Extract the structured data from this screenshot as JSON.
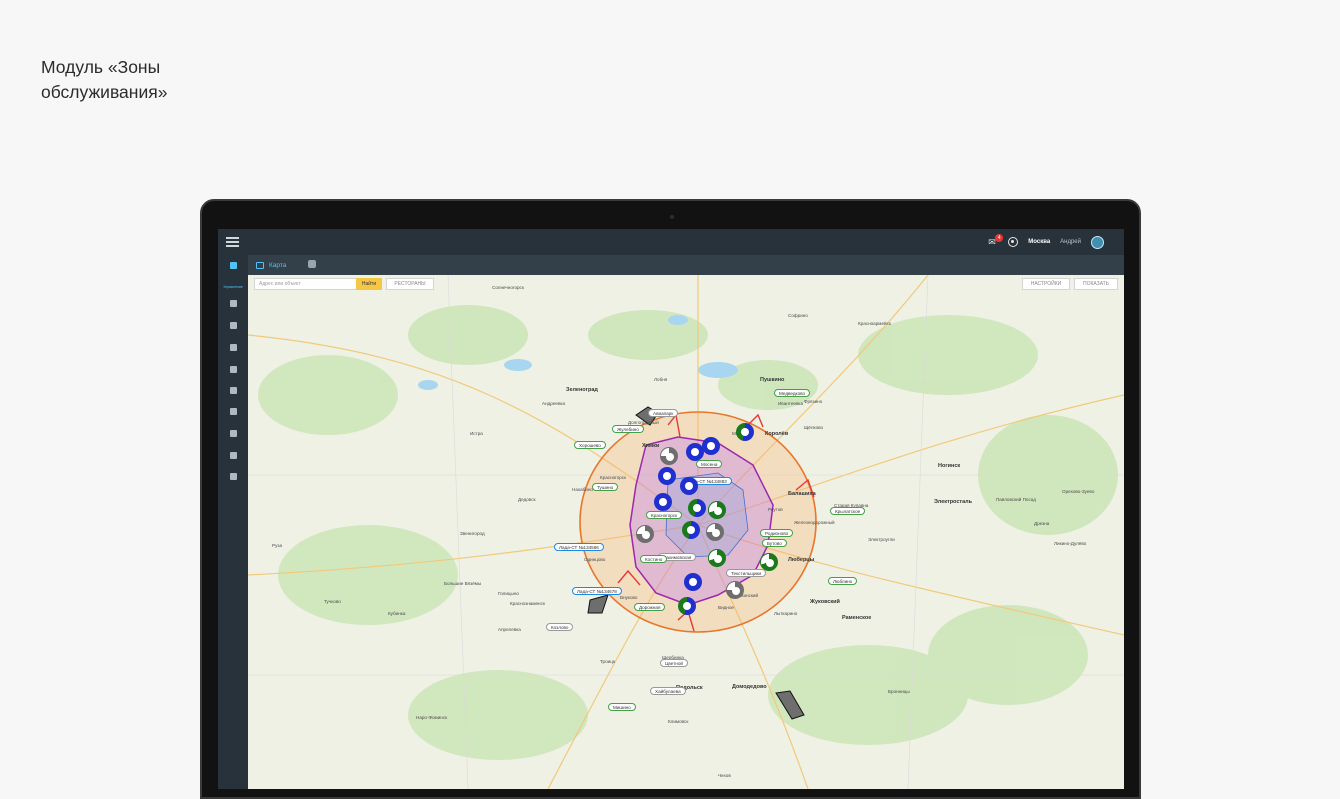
{
  "caption": "Модуль «Зоны обслуживания»",
  "topbar": {
    "notifications_count": "4",
    "city": "Москва",
    "user": "Андрей"
  },
  "tabs": {
    "map_label": "Карта"
  },
  "sidebar": {
    "active_label": "Управление"
  },
  "toolbar": {
    "search_placeholder": "Адрес или объект",
    "search_button": "Найти",
    "restaurants_button": "РЕСТОРАНЫ",
    "settings_button": "НАСТРОЙКИ",
    "show_button": "ПОКАЗАТЬ"
  },
  "map": {
    "places": [
      "Солнечногорск",
      "Зеленоград",
      "Андреевка",
      "Лобня",
      "Пушкино",
      "Долгопрудный",
      "Королёв",
      "Щёлково",
      "Мытищи",
      "Химки",
      "Красногорск",
      "Балашиха",
      "Железнодорожный",
      "Реутов",
      "Люберцы",
      "Жуковский",
      "Раменское",
      "Видное",
      "Домодедово",
      "Подольск",
      "Троицк",
      "Одинцово",
      "Внуково",
      "Истра",
      "Ногинск",
      "Электросталь",
      "Звенигород",
      "Кубинка",
      "Апрелевка",
      "Климовск",
      "Наро-Фоминск",
      "Лыткарино",
      "Дзержинский",
      "Щербинка",
      "Фрязино",
      "Ивантеевка",
      "Дедовск",
      "Нахабино",
      "Голицыно",
      "Электроугли",
      "Старая Купавна",
      "Павловский Посад",
      "Бронницы",
      "Софрино",
      "Красноармейск",
      "Дрезна",
      "Ликино-Дулёво",
      "Орехово-Зуево",
      "Чехов",
      "Руза",
      "Тучково",
      "Большие Вязёмы",
      "Краснознаменск"
    ],
    "tags": [
      "Авиапарк",
      "Мосена",
      "Лада-СТ №134883",
      "Хорошево",
      "Красногорск",
      "Тушино",
      "Лада-СТ №134566",
      "Нахимовская",
      "Костино",
      "Лада-СТ №134678",
      "Дорожная",
      "Козлово",
      "Текстильщики",
      "Родионово",
      "Бутово",
      "Крылатское",
      "Люблино",
      "Цветной",
      "Хайбулаева",
      "Мишино",
      "Жулебино",
      "Медведково"
    ]
  }
}
